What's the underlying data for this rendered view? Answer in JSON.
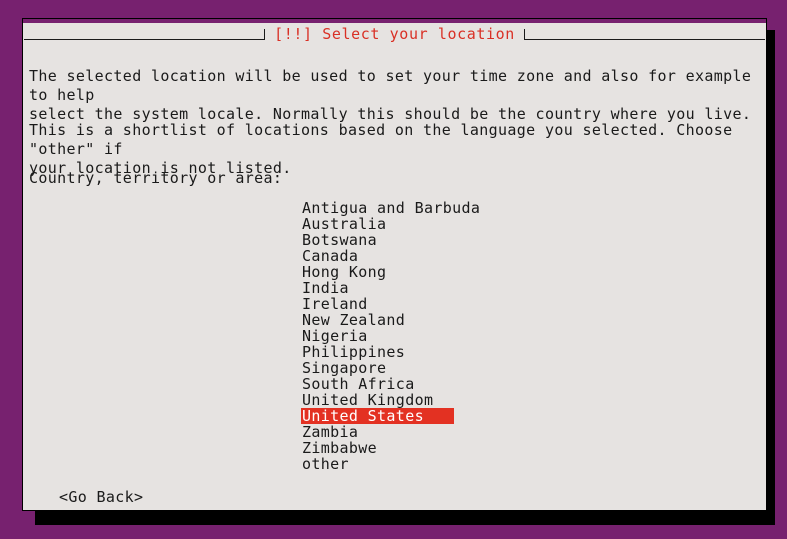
{
  "window": {
    "title": "[!!] Select your location",
    "title_color": "#d93025",
    "background_color": "#77216f",
    "dialog_background": "#e6e3e1"
  },
  "content": {
    "paragraph_intro": "The selected location will be used to set your time zone and also for example to help\nselect the system locale. Normally this should be the country where you live.",
    "paragraph_shortlist": "This is a shortlist of locations based on the language you selected. Choose \"other\" if\nyour location is not listed.",
    "field_label": "Country, territory or area:"
  },
  "country_list": {
    "selected_index": 14,
    "selected_value": "United States",
    "highlight_color": "#e33122",
    "highlight_text_color": "#ffffff",
    "items": [
      {
        "label": "Antigua and Barbuda",
        "selected": false
      },
      {
        "label": "Australia",
        "selected": false
      },
      {
        "label": "Botswana",
        "selected": false
      },
      {
        "label": "Canada",
        "selected": false
      },
      {
        "label": "Hong Kong",
        "selected": false
      },
      {
        "label": "India",
        "selected": false
      },
      {
        "label": "Ireland",
        "selected": false
      },
      {
        "label": "New Zealand",
        "selected": false
      },
      {
        "label": "Nigeria",
        "selected": false
      },
      {
        "label": "Philippines",
        "selected": false
      },
      {
        "label": "Singapore",
        "selected": false
      },
      {
        "label": "South Africa",
        "selected": false
      },
      {
        "label": "United Kingdom",
        "selected": false
      },
      {
        "label": "United States",
        "selected": true
      },
      {
        "label": "Zambia",
        "selected": false
      },
      {
        "label": "Zimbabwe",
        "selected": false
      },
      {
        "label": "other",
        "selected": false
      }
    ]
  },
  "buttons": {
    "go_back": "<Go Back>"
  }
}
